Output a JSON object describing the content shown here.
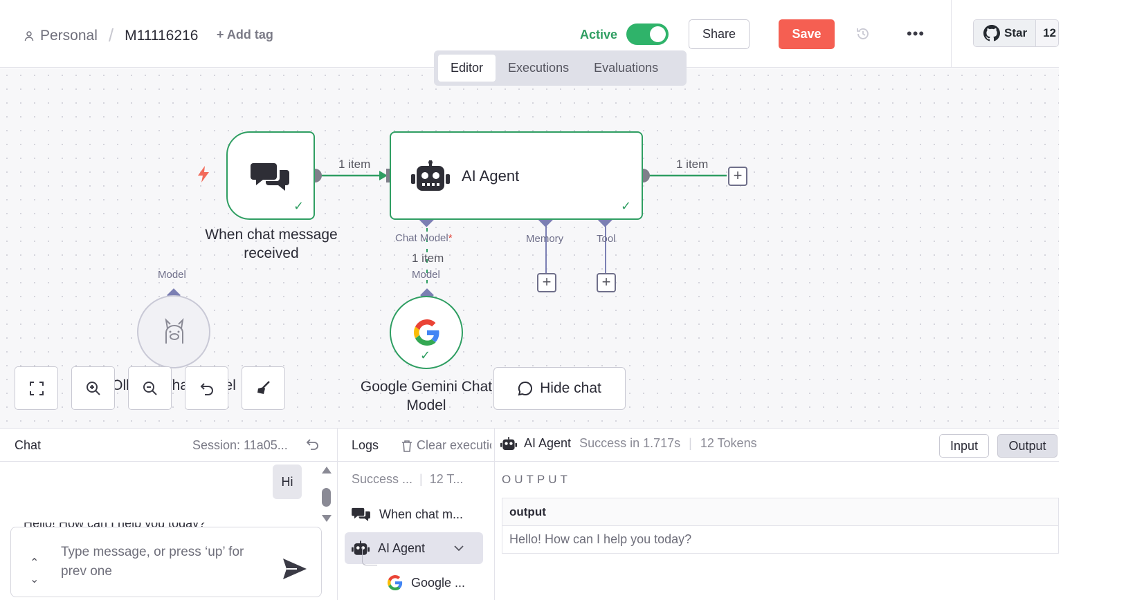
{
  "header": {
    "project": "Personal",
    "workflow_name": "M11116216",
    "add_tag": "+ Add tag",
    "active_label": "Active",
    "active": true,
    "share": "Share",
    "save": "Save",
    "more": "•••",
    "github_star": "Star",
    "github_count": "12"
  },
  "tabs": [
    "Editor",
    "Executions",
    "Evaluations"
  ],
  "active_tab": "Editor",
  "canvas": {
    "trigger_node": {
      "label_line1": "When chat message",
      "label_line2": "received",
      "icon": "chat-bubbles-icon"
    },
    "agent_node": {
      "title": "AI Agent",
      "icon": "robot-icon"
    },
    "edge_labels": {
      "trigger_to_agent": "1 item",
      "agent_out": "1 item",
      "model_link": "1 item"
    },
    "ports": {
      "chat_model": "Chat Model",
      "required_mark": "*",
      "memory": "Memory",
      "tool": "Tool",
      "model_gemini": "Model",
      "model_ollama": "Model"
    },
    "gemini_node": {
      "label_line1": "Google Gemini Chat",
      "label_line2": "Model",
      "icon": "google-icon"
    },
    "ollama_node": {
      "label_visible": "Ollama Chat Model",
      "icon": "llama-icon"
    },
    "hide_chat": "Hide chat"
  },
  "chat_panel": {
    "title": "Chat",
    "session": "Session: 11a05...",
    "user_message": "Hi",
    "assistant_message_partial": "Hello! How can I help you today?",
    "input_placeholder": "Type message, or press ‘up’ for prev one"
  },
  "logs_panel": {
    "title": "Logs",
    "clear": "Clear execution",
    "summary_status": "Success ...",
    "summary_tokens": "12 T...",
    "items": [
      {
        "label": "When chat m...",
        "icon": "chat-bubbles-icon"
      },
      {
        "label": "AI Agent",
        "icon": "robot-icon",
        "selected": true
      },
      {
        "label": "Google ...",
        "icon": "google-icon"
      }
    ]
  },
  "output_panel": {
    "node": "AI Agent",
    "status": "Success in 1.717s",
    "tokens": "12 Tokens",
    "input_btn": "Input",
    "output_btn": "Output",
    "section_label": "OUTPUT",
    "column": "output",
    "value": "Hello! How can I help you today?"
  },
  "colors": {
    "accent_green": "#2f9e62",
    "save_red": "#f55f52",
    "port_purple": "#7b7fb3"
  }
}
